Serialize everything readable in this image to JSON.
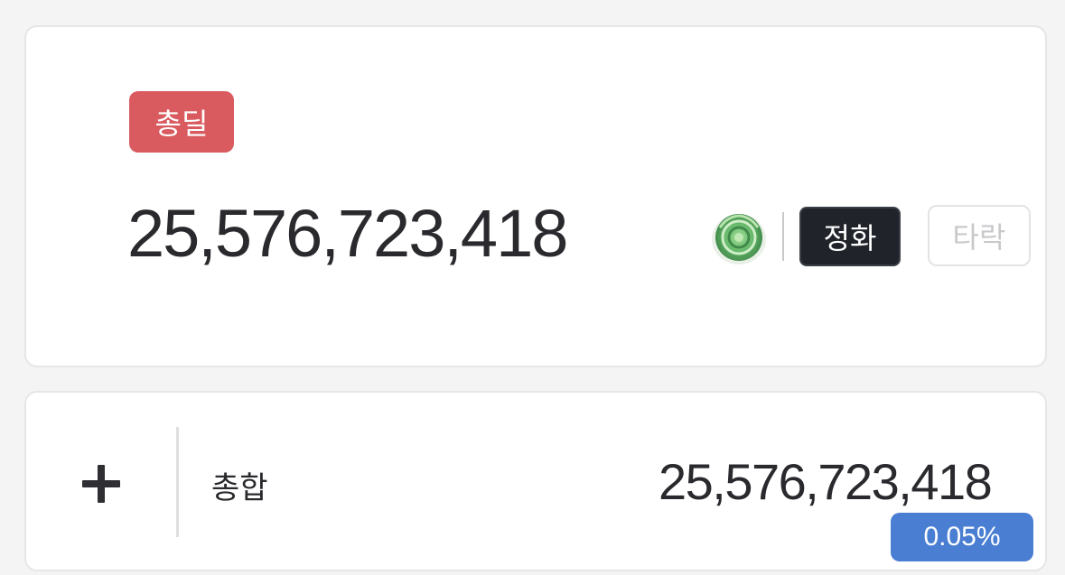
{
  "top_card": {
    "badge_label": "총딜",
    "total_value": "25,576,723,418",
    "gem_icon": "green-rose-gem-icon",
    "refine_button_label": "정화",
    "degrade_button_label": "타락"
  },
  "bottom_card": {
    "plus_icon": "plus-icon",
    "label": "총합",
    "value": "25,576,723,418",
    "percent": "0.05%"
  },
  "colors": {
    "badge_red": "#d95b60",
    "refine_dark": "#20242a",
    "percent_blue": "#4a7ed2"
  }
}
